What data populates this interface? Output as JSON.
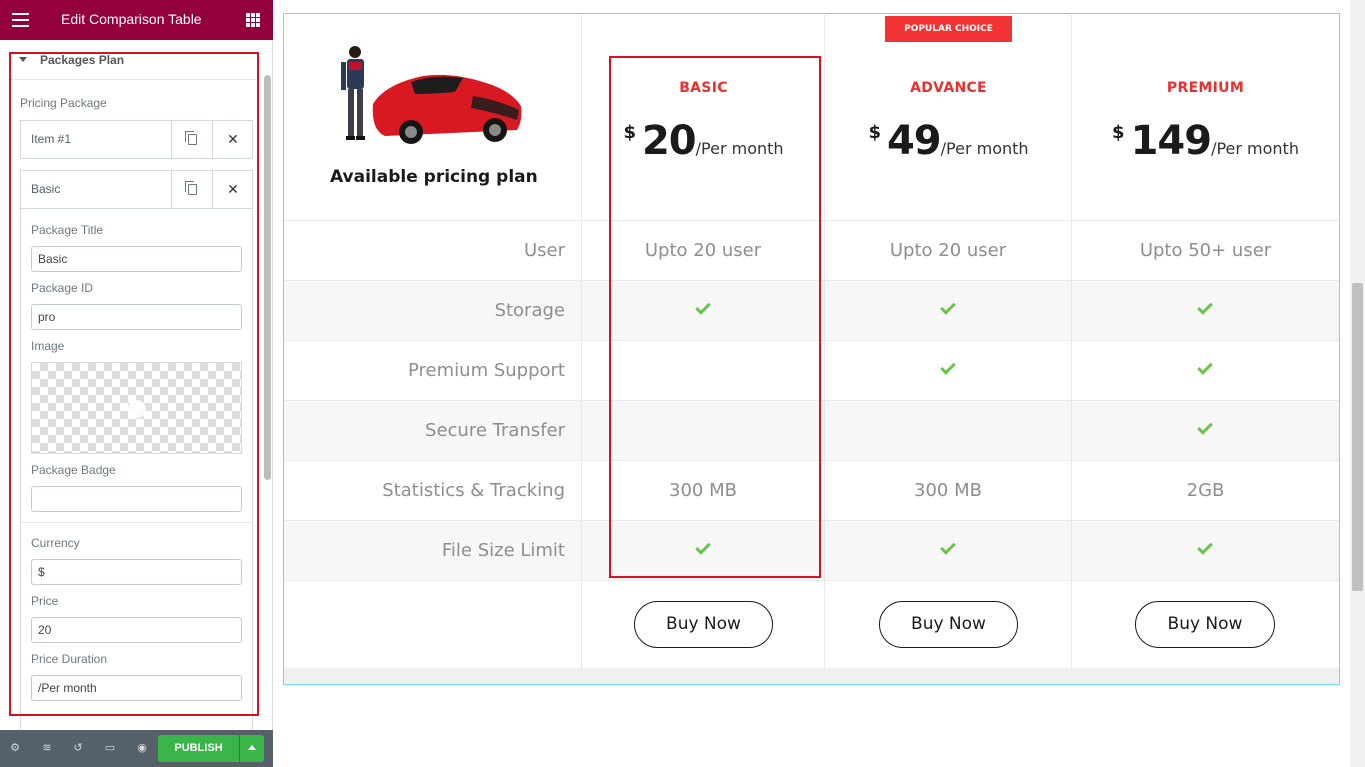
{
  "editor": {
    "title": "Edit Comparison Table",
    "section": "Packages Plan",
    "pricing_package_label": "Pricing Package",
    "items": [
      {
        "title": "Item #1"
      },
      {
        "title": "Basic"
      }
    ],
    "fields": {
      "package_title_label": "Package Title",
      "package_title_value": "Basic",
      "package_id_label": "Package ID",
      "package_id_value": "pro",
      "image_label": "Image",
      "package_badge_label": "Package Badge",
      "package_badge_value": "",
      "currency_label": "Currency",
      "currency_value": "$",
      "price_label": "Price",
      "price_value": "20",
      "price_duration_label": "Price Duration",
      "price_duration_value": "/Per month"
    },
    "footer": {
      "publish_label": "PUBLISH",
      "icons": [
        "gear-icon",
        "layers-icon",
        "history-icon",
        "responsive-icon",
        "eye-icon"
      ]
    },
    "accent_color": "#93003c"
  },
  "table": {
    "intro_text": "Available pricing plan",
    "badge": "POPULAR CHOICE",
    "plans": [
      {
        "title": "BASIC",
        "currency": "$",
        "price": "20",
        "duration": "/Per month",
        "button": "Buy Now"
      },
      {
        "title": "ADVANCE",
        "currency": "$",
        "price": "49",
        "duration": "/Per month",
        "button": "Buy Now"
      },
      {
        "title": "PREMIUM",
        "currency": "$",
        "price": "149",
        "duration": "/Per month",
        "button": "Buy Now"
      }
    ],
    "rows": [
      {
        "label": "User",
        "values": [
          "Upto 20 user",
          "Upto 20 user",
          "Upto 50+ user"
        ]
      },
      {
        "label": "Storage",
        "values": [
          "check",
          "check",
          "check"
        ]
      },
      {
        "label": "Premium Support",
        "values": [
          "",
          "check",
          "check"
        ]
      },
      {
        "label": "Secure Transfer",
        "values": [
          "",
          "",
          "check"
        ]
      },
      {
        "label": "Statistics & Tracking",
        "values": [
          "300 MB",
          "300 MB",
          "2GB"
        ]
      },
      {
        "label": "File Size Limit",
        "values": [
          "check",
          "check",
          "check"
        ]
      }
    ],
    "colors": {
      "title_red": "#e8302f",
      "check_green": "#6ac34d",
      "badge_red": "#f33234"
    }
  }
}
